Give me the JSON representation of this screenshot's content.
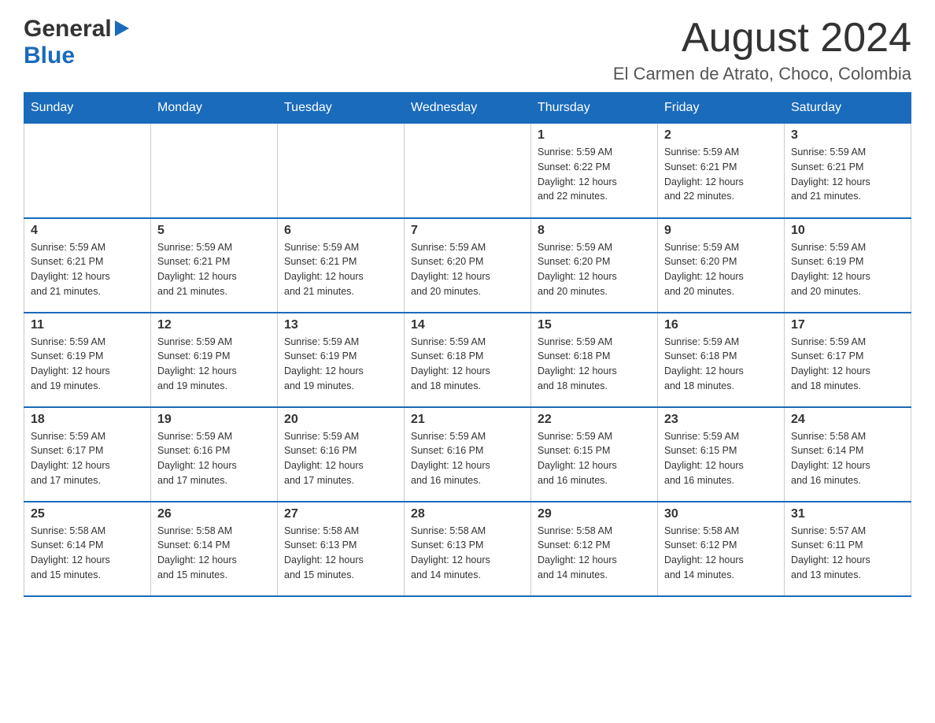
{
  "header": {
    "logo": {
      "general": "General",
      "blue": "Blue"
    },
    "title": "August 2024",
    "subtitle": "El Carmen de Atrato, Choco, Colombia"
  },
  "calendar": {
    "weekdays": [
      "Sunday",
      "Monday",
      "Tuesday",
      "Wednesday",
      "Thursday",
      "Friday",
      "Saturday"
    ],
    "weeks": [
      [
        {
          "day": "",
          "info": ""
        },
        {
          "day": "",
          "info": ""
        },
        {
          "day": "",
          "info": ""
        },
        {
          "day": "",
          "info": ""
        },
        {
          "day": "1",
          "info": "Sunrise: 5:59 AM\nSunset: 6:22 PM\nDaylight: 12 hours\nand 22 minutes."
        },
        {
          "day": "2",
          "info": "Sunrise: 5:59 AM\nSunset: 6:21 PM\nDaylight: 12 hours\nand 22 minutes."
        },
        {
          "day": "3",
          "info": "Sunrise: 5:59 AM\nSunset: 6:21 PM\nDaylight: 12 hours\nand 21 minutes."
        }
      ],
      [
        {
          "day": "4",
          "info": "Sunrise: 5:59 AM\nSunset: 6:21 PM\nDaylight: 12 hours\nand 21 minutes."
        },
        {
          "day": "5",
          "info": "Sunrise: 5:59 AM\nSunset: 6:21 PM\nDaylight: 12 hours\nand 21 minutes."
        },
        {
          "day": "6",
          "info": "Sunrise: 5:59 AM\nSunset: 6:21 PM\nDaylight: 12 hours\nand 21 minutes."
        },
        {
          "day": "7",
          "info": "Sunrise: 5:59 AM\nSunset: 6:20 PM\nDaylight: 12 hours\nand 20 minutes."
        },
        {
          "day": "8",
          "info": "Sunrise: 5:59 AM\nSunset: 6:20 PM\nDaylight: 12 hours\nand 20 minutes."
        },
        {
          "day": "9",
          "info": "Sunrise: 5:59 AM\nSunset: 6:20 PM\nDaylight: 12 hours\nand 20 minutes."
        },
        {
          "day": "10",
          "info": "Sunrise: 5:59 AM\nSunset: 6:19 PM\nDaylight: 12 hours\nand 20 minutes."
        }
      ],
      [
        {
          "day": "11",
          "info": "Sunrise: 5:59 AM\nSunset: 6:19 PM\nDaylight: 12 hours\nand 19 minutes."
        },
        {
          "day": "12",
          "info": "Sunrise: 5:59 AM\nSunset: 6:19 PM\nDaylight: 12 hours\nand 19 minutes."
        },
        {
          "day": "13",
          "info": "Sunrise: 5:59 AM\nSunset: 6:19 PM\nDaylight: 12 hours\nand 19 minutes."
        },
        {
          "day": "14",
          "info": "Sunrise: 5:59 AM\nSunset: 6:18 PM\nDaylight: 12 hours\nand 18 minutes."
        },
        {
          "day": "15",
          "info": "Sunrise: 5:59 AM\nSunset: 6:18 PM\nDaylight: 12 hours\nand 18 minutes."
        },
        {
          "day": "16",
          "info": "Sunrise: 5:59 AM\nSunset: 6:18 PM\nDaylight: 12 hours\nand 18 minutes."
        },
        {
          "day": "17",
          "info": "Sunrise: 5:59 AM\nSunset: 6:17 PM\nDaylight: 12 hours\nand 18 minutes."
        }
      ],
      [
        {
          "day": "18",
          "info": "Sunrise: 5:59 AM\nSunset: 6:17 PM\nDaylight: 12 hours\nand 17 minutes."
        },
        {
          "day": "19",
          "info": "Sunrise: 5:59 AM\nSunset: 6:16 PM\nDaylight: 12 hours\nand 17 minutes."
        },
        {
          "day": "20",
          "info": "Sunrise: 5:59 AM\nSunset: 6:16 PM\nDaylight: 12 hours\nand 17 minutes."
        },
        {
          "day": "21",
          "info": "Sunrise: 5:59 AM\nSunset: 6:16 PM\nDaylight: 12 hours\nand 16 minutes."
        },
        {
          "day": "22",
          "info": "Sunrise: 5:59 AM\nSunset: 6:15 PM\nDaylight: 12 hours\nand 16 minutes."
        },
        {
          "day": "23",
          "info": "Sunrise: 5:59 AM\nSunset: 6:15 PM\nDaylight: 12 hours\nand 16 minutes."
        },
        {
          "day": "24",
          "info": "Sunrise: 5:58 AM\nSunset: 6:14 PM\nDaylight: 12 hours\nand 16 minutes."
        }
      ],
      [
        {
          "day": "25",
          "info": "Sunrise: 5:58 AM\nSunset: 6:14 PM\nDaylight: 12 hours\nand 15 minutes."
        },
        {
          "day": "26",
          "info": "Sunrise: 5:58 AM\nSunset: 6:14 PM\nDaylight: 12 hours\nand 15 minutes."
        },
        {
          "day": "27",
          "info": "Sunrise: 5:58 AM\nSunset: 6:13 PM\nDaylight: 12 hours\nand 15 minutes."
        },
        {
          "day": "28",
          "info": "Sunrise: 5:58 AM\nSunset: 6:13 PM\nDaylight: 12 hours\nand 14 minutes."
        },
        {
          "day": "29",
          "info": "Sunrise: 5:58 AM\nSunset: 6:12 PM\nDaylight: 12 hours\nand 14 minutes."
        },
        {
          "day": "30",
          "info": "Sunrise: 5:58 AM\nSunset: 6:12 PM\nDaylight: 12 hours\nand 14 minutes."
        },
        {
          "day": "31",
          "info": "Sunrise: 5:57 AM\nSunset: 6:11 PM\nDaylight: 12 hours\nand 13 minutes."
        }
      ]
    ]
  }
}
